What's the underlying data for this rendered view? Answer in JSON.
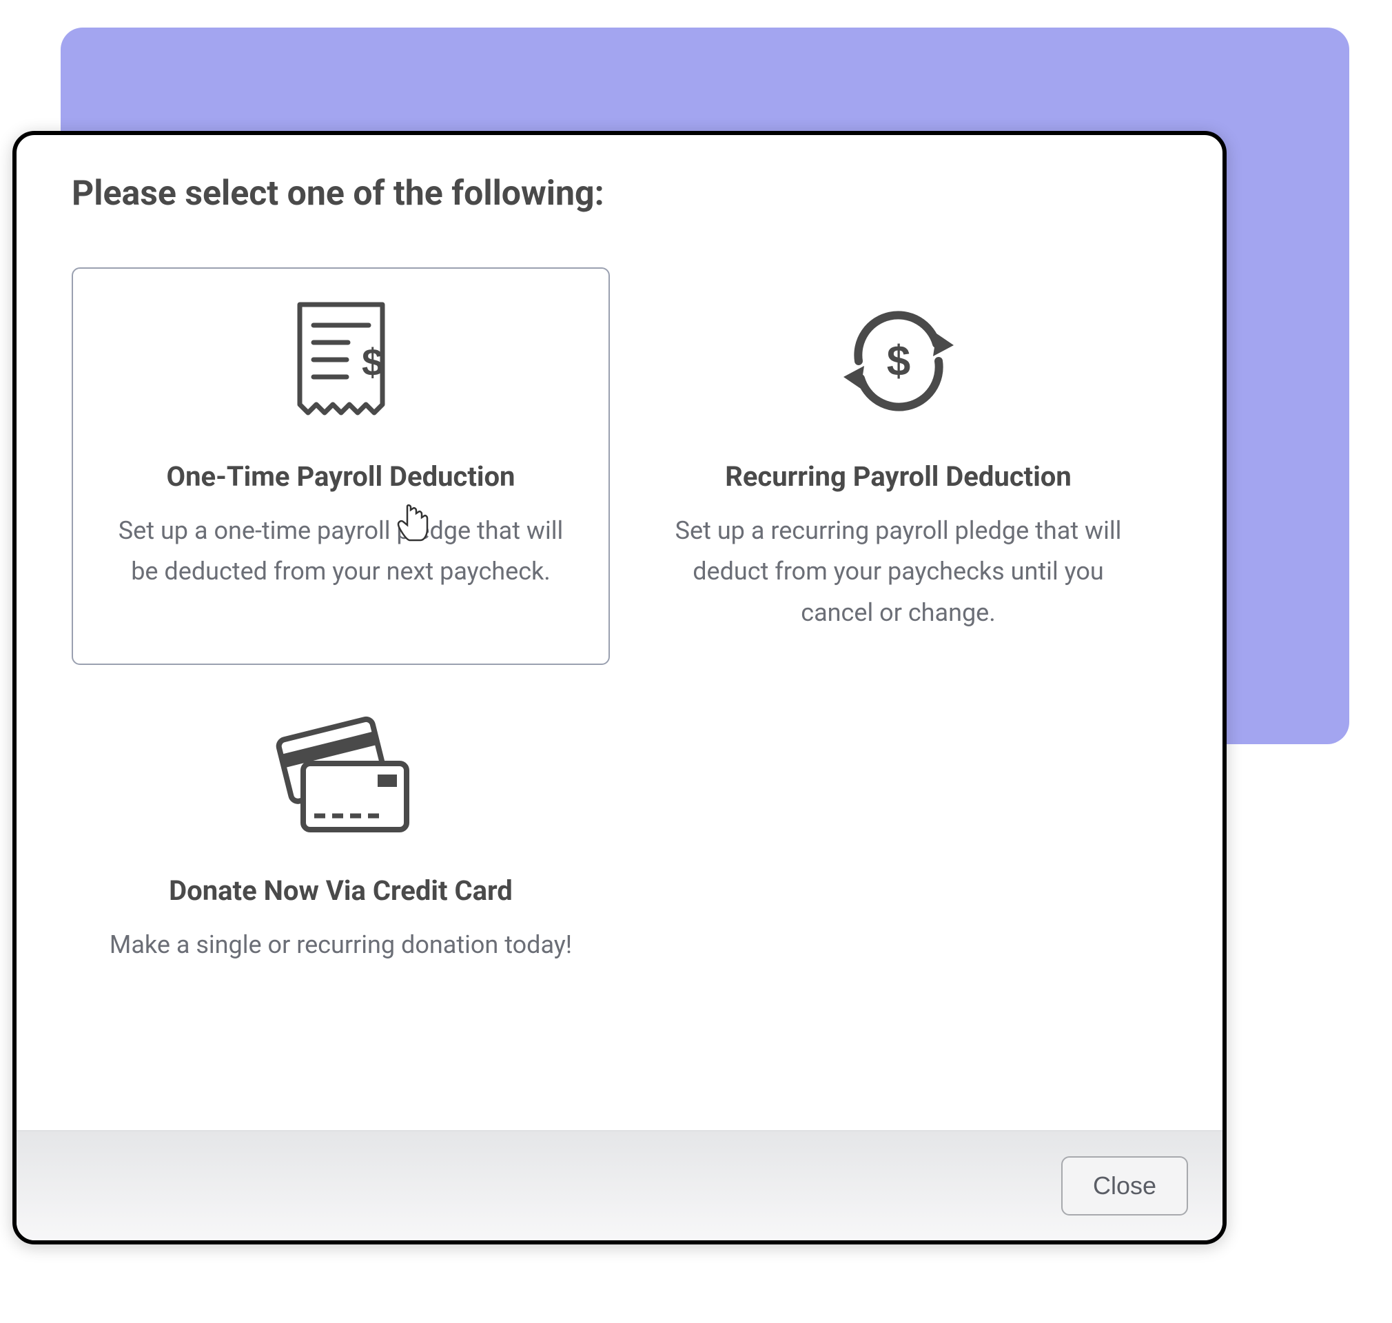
{
  "modal": {
    "title": "Please select one of the following:",
    "options": [
      {
        "icon": "receipt-dollar-icon",
        "title": "One-Time Payroll Deduction",
        "description": "Set up a one-time payroll pledge that will be deducted from your next paycheck.",
        "selected": true
      },
      {
        "icon": "recurring-dollar-icon",
        "title": "Recurring Payroll Deduction",
        "description": "Set up a recurring payroll pledge that will deduct from your paychecks until you cancel or change.",
        "selected": false
      },
      {
        "icon": "credit-cards-icon",
        "title": "Donate Now Via Credit Card",
        "description": "Make a single or recurring donation today!",
        "selected": false
      }
    ],
    "close_label": "Close"
  }
}
